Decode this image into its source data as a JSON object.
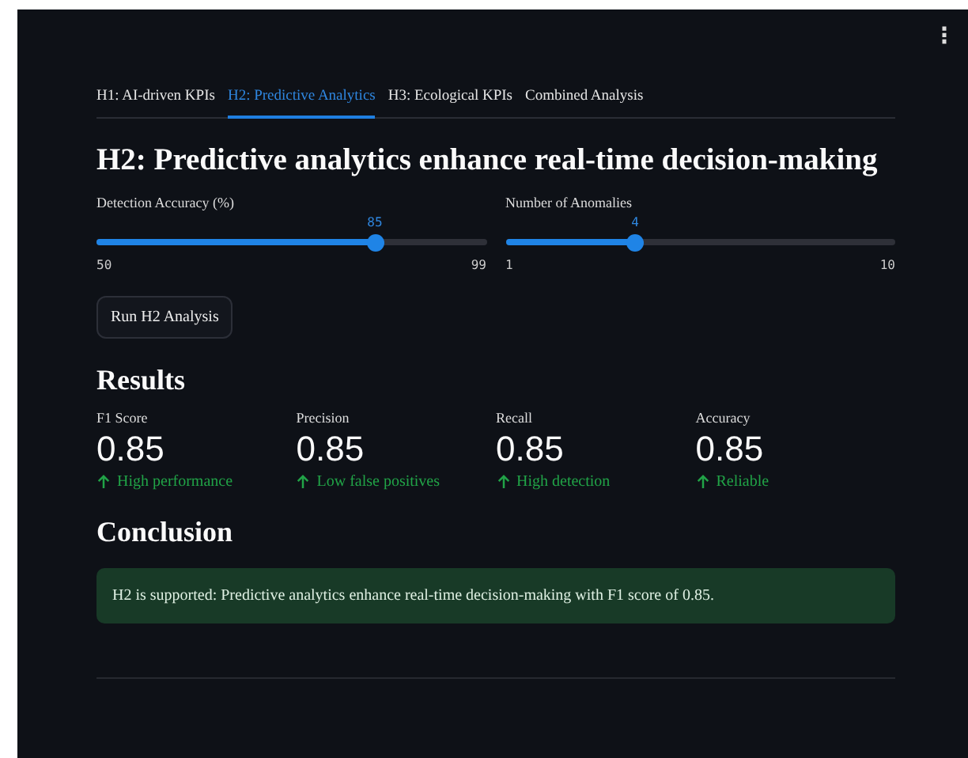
{
  "menu_icon": "⋮",
  "tabs": [
    {
      "label": "H1: AI-driven KPIs",
      "selected": false
    },
    {
      "label": "H2: Predictive Analytics",
      "selected": true
    },
    {
      "label": "H3: Ecological KPIs",
      "selected": false
    },
    {
      "label": "Combined Analysis",
      "selected": false
    }
  ],
  "title": "H2: Predictive analytics enhance real-time decision-making",
  "sliders": [
    {
      "label": "Detection Accuracy (%)",
      "value": "85",
      "min": "50",
      "max": "99",
      "level": 0.714
    },
    {
      "label": "Number of Anomalies",
      "value": "4",
      "min": "1",
      "max": "10",
      "level": 0.333
    }
  ],
  "button": "Run H2 Analysis",
  "results_heading": "Results",
  "metrics": [
    {
      "label": "F1 Score",
      "value": "0.85",
      "delta": "High performance"
    },
    {
      "label": "Precision",
      "value": "0.85",
      "delta": "Low false positives"
    },
    {
      "label": "Recall",
      "value": "0.85",
      "delta": "High detection"
    },
    {
      "label": "Accuracy",
      "value": "0.85",
      "delta": "Reliable"
    }
  ],
  "conclusion_heading": "Conclusion",
  "conclusion": "H2 is supported: Predictive analytics enhance real-time decision-making with F1 score of 0.85."
}
